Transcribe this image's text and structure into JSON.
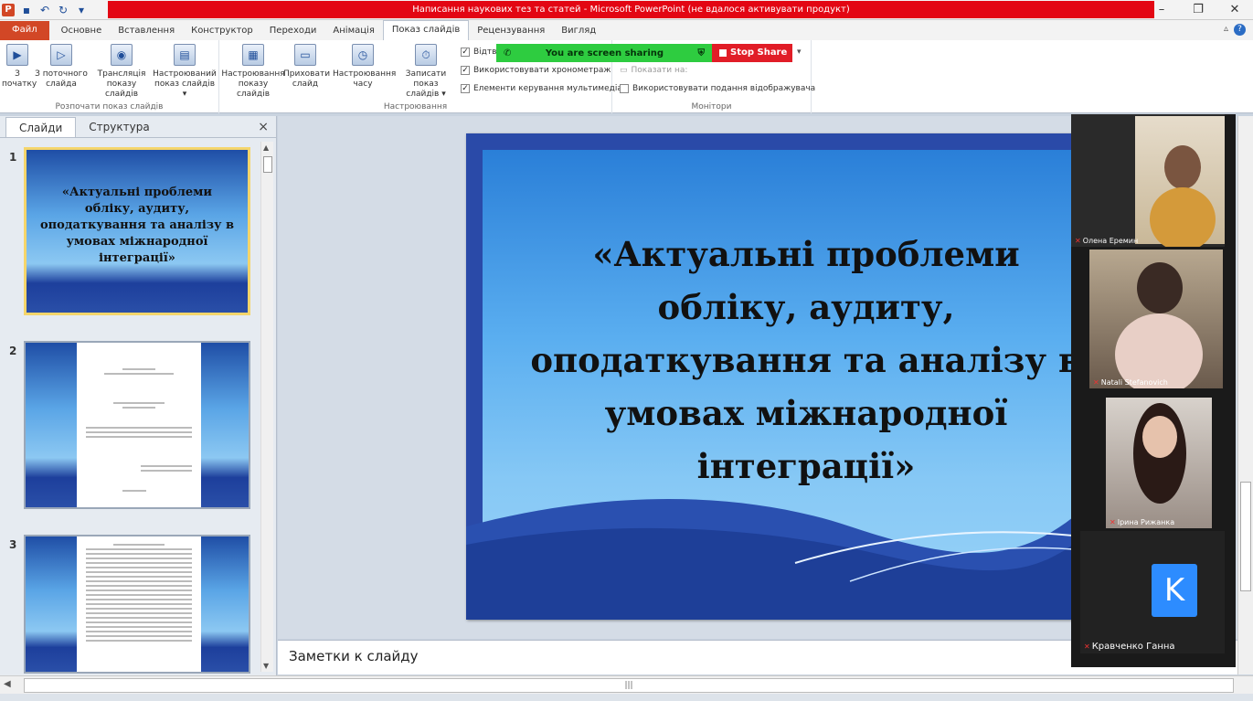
{
  "window": {
    "title": "Написання наукових тез та статей  -  Microsoft PowerPoint (не вдалося активувати продукт)",
    "app_letter": "P",
    "accent": "#d24726"
  },
  "tabs": [
    "Основне",
    "Вставлення",
    "Конструктор",
    "Переходи",
    "Анімація",
    "Показ слайдів",
    "Рецензування",
    "Вигляд"
  ],
  "file_tab": "Файл",
  "active_tab": "Показ слайдів",
  "ribbon": {
    "start_group": {
      "label": "Розпочати показ слайдів",
      "buttons": [
        {
          "line1": "З",
          "line2": "початку"
        },
        {
          "line1": "З поточного",
          "line2": "слайда"
        },
        {
          "line1": "Трансляція",
          "line2": "показу слайдів"
        },
        {
          "line1": "Настроюваний",
          "line2": "показ слайдів ▾"
        }
      ]
    },
    "setup_group": {
      "label": "Настроювання",
      "buttons": [
        {
          "line1": "Настроювання",
          "line2": "показу слайдів"
        },
        {
          "line1": "Приховати",
          "line2": "слайд"
        },
        {
          "line1": "Настроювання",
          "line2": "часу"
        },
        {
          "line1": "Записати показ",
          "line2": "слайдів ▾"
        }
      ],
      "checks": [
        {
          "label": "Відтв",
          "checked": true
        },
        {
          "label": "Використовувати хронометраж",
          "checked": true
        },
        {
          "label": "Елементи керування мультимедіа",
          "checked": true
        }
      ]
    },
    "monitors_group": {
      "label": "Монітори",
      "show_on": "Показати на:",
      "presenter_view": "Використовувати подання відображувача"
    }
  },
  "zoom": {
    "sharing_text": "You are screen sharing",
    "stop_share": "Stop Share"
  },
  "left_pane": {
    "tabs": [
      "Слайди",
      "Структура"
    ],
    "close_icon": "×",
    "thumb_title": "«Актуальні проблеми обліку, аудиту, оподаткування та аналізу в умовах міжнародної інтеграції»",
    "slides": [
      {
        "num": "1"
      },
      {
        "num": "2"
      },
      {
        "num": "3"
      }
    ]
  },
  "slide": {
    "title_lines": [
      "«Актуальні проблеми",
      "обліку, аудиту,",
      "оподаткування та аналізу в",
      "умовах міжнародної",
      "інтеграції»"
    ]
  },
  "notes_placeholder": "Заметки к слайду",
  "participants": [
    {
      "name": "Олена Еремин"
    },
    {
      "name": "Natali Stefanovich"
    },
    {
      "name": "Ірина Рижанка"
    },
    {
      "name": "Кравченко  Ганна",
      "initial": "K"
    }
  ]
}
